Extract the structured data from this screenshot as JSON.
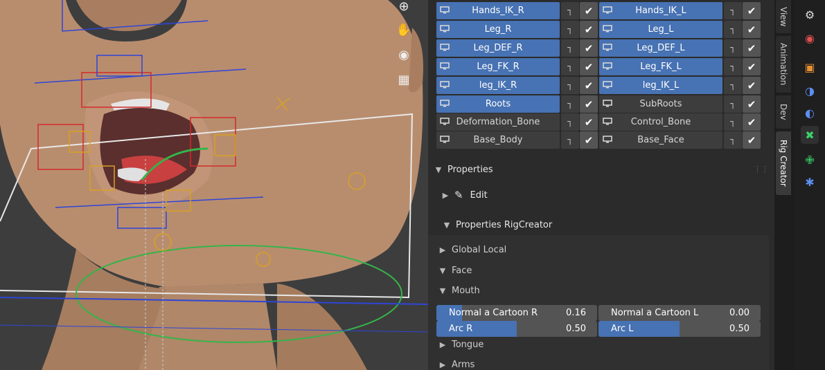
{
  "bone_collections": {
    "rows": [
      {
        "left": {
          "name": "Hands_IK_R",
          "selected": true
        },
        "right": {
          "name": "Hands_IK_L",
          "selected": true
        }
      },
      {
        "left": {
          "name": "Leg_R",
          "selected": true
        },
        "right": {
          "name": "Leg_L",
          "selected": true
        }
      },
      {
        "left": {
          "name": "Leg_DEF_R",
          "selected": true
        },
        "right": {
          "name": "Leg_DEF_L",
          "selected": true
        }
      },
      {
        "left": {
          "name": "Leg_FK_R",
          "selected": true
        },
        "right": {
          "name": "Leg_FK_L",
          "selected": true
        }
      },
      {
        "left": {
          "name": "leg_IK_R",
          "selected": true
        },
        "right": {
          "name": "leg_IK_L",
          "selected": true
        }
      },
      {
        "left": {
          "name": "Roots",
          "selected": true
        },
        "right": {
          "name": "SubRoots",
          "selected": false
        }
      },
      {
        "left": {
          "name": "Deformation_Bone",
          "selected": false
        },
        "right": {
          "name": "Control_Bone",
          "selected": false
        }
      },
      {
        "left": {
          "name": "Base_Body",
          "selected": false
        },
        "right": {
          "name": "Base_Face",
          "selected": false
        }
      }
    ]
  },
  "properties": {
    "header": "Properties",
    "edit": "Edit",
    "rigcreator_header": "Properties RigCreator",
    "global_local": "Global Local",
    "face": "Face",
    "mouth": "Mouth",
    "tongue": "Tongue",
    "arms": "Arms"
  },
  "sliders": [
    {
      "label": "Normal a Cartoon R",
      "value": "0.16",
      "fraction": 0.16
    },
    {
      "label": "Normal a Cartoon L",
      "value": "0.00",
      "fraction": 0.0
    },
    {
      "label": "Arc R",
      "value": "0.50",
      "fraction": 0.5
    },
    {
      "label": "Arc L",
      "value": "0.50",
      "fraction": 0.5
    }
  ],
  "tabs": {
    "view": "View",
    "animation": "Animation",
    "dev": "Dev",
    "rig_creator": "Rig Creator"
  },
  "colors": {
    "accent": "#4772b3",
    "armature_green": "#3ad26a"
  },
  "icons": {
    "viewport": [
      "zoom-icon",
      "hand-pan-icon",
      "camera-icon",
      "grid-icon"
    ],
    "properties": [
      "tool-icon",
      "scene-icon",
      "object-icon",
      "modifier-icon",
      "physics-icon",
      "armature-icon",
      "bone-icon",
      "bone-constraint-icon"
    ]
  }
}
